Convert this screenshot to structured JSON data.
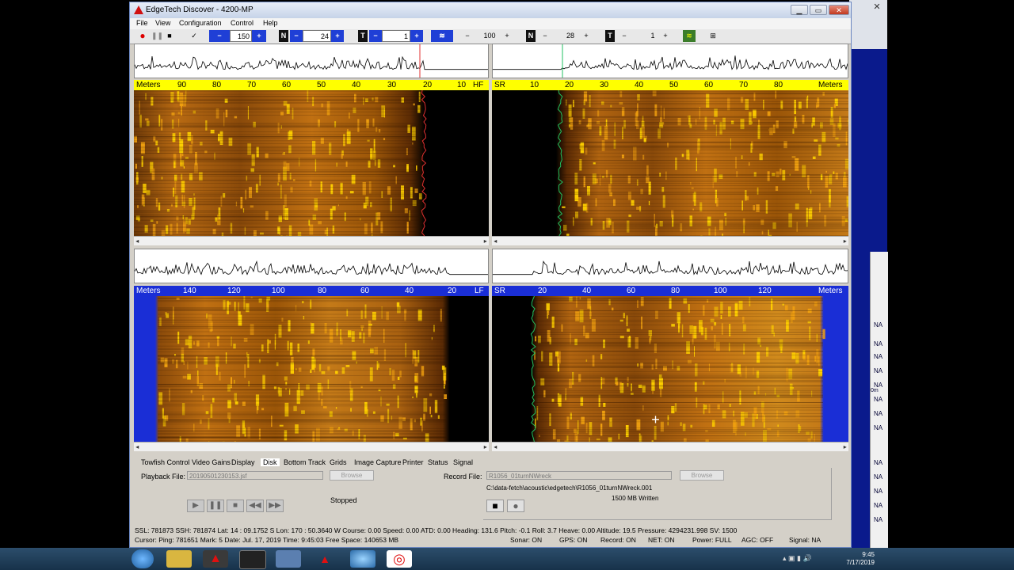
{
  "window": {
    "title": "EdgeTech Discover - 4200-MP",
    "menu": [
      "File",
      "View",
      "Configuration",
      "Control",
      "Help"
    ]
  },
  "toolbar": {
    "range1": "150",
    "gain1": "24",
    "tvg1": "1",
    "range2": "100",
    "gain2": "28",
    "tvg2": "1",
    "labels": {
      "n": "N",
      "t": "T",
      "minus": "−",
      "plus": "+"
    }
  },
  "hf_port": {
    "unit": "Meters",
    "end": "HF",
    "ticks": [
      "90",
      "80",
      "70",
      "60",
      "50",
      "40",
      "30",
      "20",
      "10"
    ]
  },
  "hf_stbd": {
    "start": "SR",
    "unit": "Meters",
    "ticks": [
      "10",
      "20",
      "30",
      "40",
      "50",
      "60",
      "70",
      "80"
    ]
  },
  "lf_port": {
    "unit": "Meters",
    "end": "LF",
    "ticks": [
      "140",
      "120",
      "100",
      "80",
      "60",
      "40",
      "20"
    ]
  },
  "lf_stbd": {
    "start": "SR",
    "unit": "Meters",
    "ticks": [
      "20",
      "40",
      "60",
      "80",
      "100",
      "120"
    ]
  },
  "tabs": [
    "Towfish Control",
    "Video Gains",
    "Display",
    "Disk",
    "Bottom Track",
    "Grids",
    "Image Capture",
    "Printer",
    "Status",
    "Signal"
  ],
  "disk": {
    "playback_label": "Playback File:",
    "playback_value": "20190501230153.jsf",
    "browse": "Browse",
    "record_label": "Record File:",
    "record_value": "R1056_01turnNWreck",
    "record_path": "C:\\data-fetch\\acoustic\\edgetech\\R1056_01turnNWreck.001",
    "written": "1500 MB Written",
    "playback_status": "Stopped"
  },
  "status_line1": "SSL: 781873  SSH: 781874   Lat:  14 : 09.1752 S   Lon:  170 : 50.3640 W   Course: 0.00   Speed:  0.00   ATD:  0.00   Heading: 131.6   Pitch:  -0.1   Roll:   3.7   Heave:  0.00   Altitude:  19.5   Pressure: 4294231.998      SV:  1500",
  "status_line2": {
    "left": "Cursor: Ping: 781651   Mark:      5   Date: Jul. 17, 2019   Time:  9:45:03   Free Space: 140653 MB",
    "sonar": "Sonar: ON",
    "gps": "GPS: ON",
    "record": "Record: ON",
    "net": "NET: ON",
    "power": "Power: FULL",
    "agc": "AGC: OFF",
    "signal": "Signal: NA"
  },
  "side_window": {
    "na": "NA",
    "m": "0m"
  },
  "clock": {
    "time": "9:45",
    "date": "7/17/2019"
  },
  "colors": {
    "scale_yellow": "#ffff00",
    "scale_blue": "#1a2ed6",
    "toolbar_blue": "#1f3fd6",
    "sonar_dark": "#1a0a00",
    "sonar_gold": "#ffd000"
  }
}
